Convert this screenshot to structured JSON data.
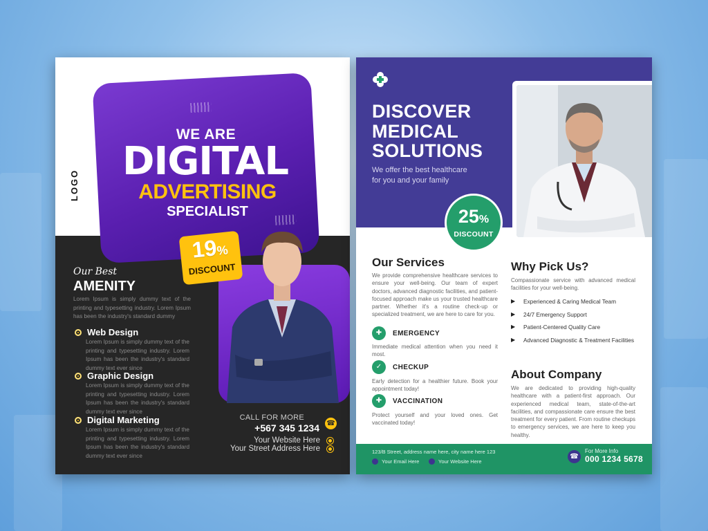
{
  "flyer_left": {
    "logo": "LOGO",
    "headline_top": "WE ARE",
    "headline_main": "DIGITAL",
    "headline_accent": "ADVERTISING",
    "headline_bottom": "SPECIALIST",
    "discount_value": "19",
    "discount_unit": "%",
    "discount_label": "DISCOUNT",
    "section_script": "Our Best",
    "section_title": "AMENITY",
    "section_text": "Lorem Ipsum is simply dummy text of the printing and typesetting industry. Lorem Ipsum has been the industry's standard dummy",
    "services": [
      {
        "title": "Web Design",
        "text": "Lorem Ipsum is simply dummy text of the printing and typesetting industry. Lorem Ipsum has been the industry's standard dummy text ever since"
      },
      {
        "title": "Graphic Design",
        "text": "Lorem Ipsum is simply dummy text of the printing and typesetting industry. Lorem Ipsum has been the industry's standard dummy text ever since"
      },
      {
        "title": "Digital Marketing",
        "text": "Lorem Ipsum is simply dummy text of the printing and typesetting industry. Lorem Ipsum has been the industry's standard dummy text ever since"
      }
    ],
    "call_label": "CALL FOR MORE",
    "phone": "+567 345 1234",
    "website": "Your Website Here",
    "address": "Your Street Address Here",
    "colors": {
      "purple": "#5a1fb0",
      "yellow": "#ffc20e",
      "dark": "#262626"
    }
  },
  "flyer_right": {
    "headline": [
      "DISCOVER",
      "MEDICAL",
      "SOLUTIONS"
    ],
    "subtitle": [
      "We offer the best healthcare",
      "for you and your family"
    ],
    "discount_value": "25",
    "discount_unit": "%",
    "discount_label": "DISCOUNT",
    "services_title": "Our Services",
    "services_text": "We provide comprehensive healthcare services to ensure your well-being. Our team of expert doctors, advanced diagnostic facilities, and patient-focused approach make us your trusted healthcare partner. Whether it's a routine check-up or specialized treatment, we are here to care for you.",
    "services": [
      {
        "label": "EMERGENCY",
        "text": "Immediate medical attention when you need it most.",
        "icon": "ambulance-icon"
      },
      {
        "label": "CHECKUP",
        "text": "Early detection for a healthier future. Book your appointment today!",
        "icon": "stethoscope-icon"
      },
      {
        "label": "VACCINATION",
        "text": "Protect yourself and your loved ones. Get vaccinated today!",
        "icon": "syringe-icon"
      }
    ],
    "why_title": "Why Pick Us?",
    "why_text": "Compassionate service with advanced medical facilities for your well-being.",
    "why_items": [
      "Experienced & Caring Medical Team",
      "24/7 Emergency Support",
      "Patient-Centered Quality Care",
      "Advanced Diagnostic & Treatment Facilities"
    ],
    "about_title": "About Company",
    "about_text": "We are dedicated to providing high-quality healthcare with a patient-first approach. Our experienced medical team, state-of-the-art facilities, and compassionate care ensure the best treatment for every patient. From routine checkups to emergency services, we are here to keep you healthy.",
    "address": "123/B Street, address name here, city name here 123",
    "email": "Your Email Here",
    "website": "Your Website Here",
    "more_info_label": "For More Info",
    "phone": "000 1234 5678",
    "colors": {
      "indigo": "#433c96",
      "green": "#249e6b"
    }
  }
}
